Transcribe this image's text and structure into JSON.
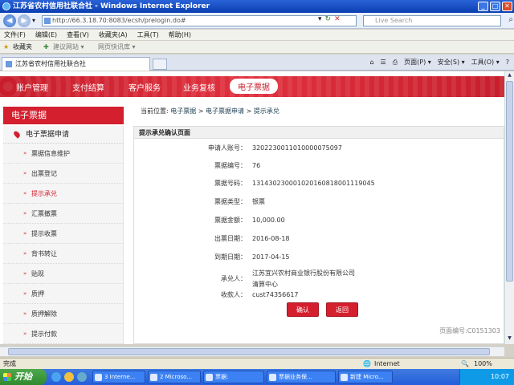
{
  "window": {
    "title": "江苏省农村信用社联合社 - Windows Internet Explorer",
    "url": "http://66.3.18.70:8083/ecsh/prelogin.do#",
    "search_placeholder": "Live Search"
  },
  "menu": [
    "文件(F)",
    "编辑(E)",
    "查看(V)",
    "收藏夹(A)",
    "工具(T)",
    "帮助(H)"
  ],
  "favorites": {
    "label": "收藏夹",
    "items": [
      "建议网站 ▾",
      "网页快讯库 ▾"
    ]
  },
  "tab": {
    "title": "江苏省农村信用社联合社"
  },
  "commandbar": [
    "页面(P) ▾",
    "安全(S) ▾",
    "工具(O) ▾"
  ],
  "topnav": [
    "账户管理",
    "支付结算",
    "客户服务",
    "业务复核",
    "电子票据"
  ],
  "sidebar": {
    "title": "电子票据",
    "group": "电子票据申请",
    "items": [
      "票据信息维护",
      "出票登记",
      "提示承兑",
      "汇票撤票",
      "提示收票",
      "背书转让",
      "贴现",
      "质押",
      "质押解除",
      "提示付款"
    ]
  },
  "breadcrumb": {
    "prefix": "当前位置:",
    "items": [
      "电子票据",
      "电子票据申请",
      "提示承兑"
    ],
    "sep": ">"
  },
  "panel": {
    "title": "提示承兑确认页面",
    "fields": [
      {
        "label": "申请人账号：",
        "value": "3202230011010000075097"
      },
      {
        "label": "票据编号：",
        "value": "76"
      },
      {
        "label": "票据号码：",
        "value": "131430230001020160818001119045"
      },
      {
        "label": "票据类型：",
        "value": "银票"
      },
      {
        "label": "票据金额：",
        "value": "10,000.00"
      },
      {
        "label": "出票日期：",
        "value": "2016-08-18"
      },
      {
        "label": "到期日期：",
        "value": "2017-04-15"
      },
      {
        "label": "承兑人：",
        "value": "江苏宜兴农村商业银行股份有限公司清算中心"
      },
      {
        "label": "收款人：",
        "value": "cust74356617"
      }
    ],
    "confirm_label": "确认",
    "back_label": "返回",
    "page_code": "页面编号:C0151303"
  },
  "status": {
    "left": "完成",
    "zone": "Internet",
    "zoom": "100%"
  },
  "taskbar": {
    "start": "开始",
    "tasks": [
      "3 Interne...",
      "2 Microso...",
      "票据:",
      "票据业务保...",
      "新建 Micro..."
    ],
    "clock": "10:07"
  }
}
